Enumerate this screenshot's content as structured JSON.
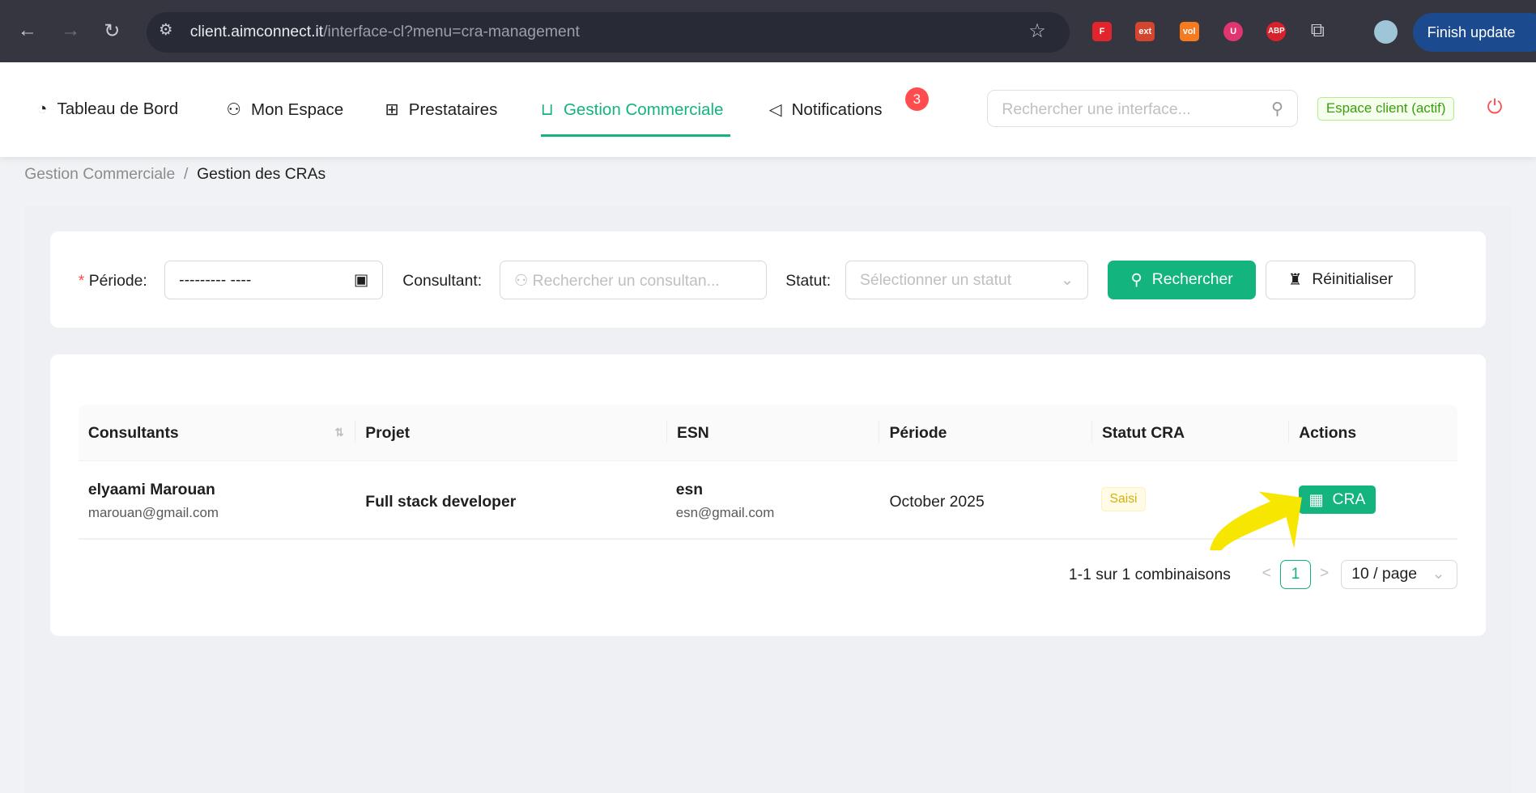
{
  "browser": {
    "url_host": "client.aimconnect.it",
    "url_path": "/interface-cl?menu=cra-management",
    "finish_update": "Finish update",
    "extensions": [
      "F",
      "ext",
      "vol",
      "U",
      "ABP"
    ]
  },
  "nav": {
    "items": [
      {
        "label": "Tableau de Bord",
        "icon": "dashboard-icon"
      },
      {
        "label": "Mon Espace",
        "icon": "user-icon"
      },
      {
        "label": "Prestataires",
        "icon": "blocks-icon"
      },
      {
        "label": "Gestion Commerciale",
        "icon": "shopping-bag-icon",
        "active": true
      },
      {
        "label": "Notifications",
        "icon": "megaphone-icon"
      }
    ],
    "notification_count": "3",
    "search_placeholder": "Rechercher une interface...",
    "client_tag": "Espace client (actif)",
    "accent": "#13b47e"
  },
  "breadcrumb": {
    "parent": "Gestion Commerciale",
    "separator": "/",
    "current": "Gestion des CRAs"
  },
  "filters": {
    "required_mark": "*",
    "periode_label": "Période",
    "periode_value": "--------- ----",
    "consultant_label": "Consultant",
    "consultant_placeholder": "Rechercher un consultan...",
    "statut_label": "Statut",
    "statut_placeholder": "Sélectionner un statut",
    "colon": ":",
    "search_button": "Rechercher",
    "reset_button": "Réinitialiser"
  },
  "table": {
    "columns": [
      "Consultants",
      "Projet",
      "ESN",
      "Période",
      "Statut CRA",
      "Actions"
    ],
    "rows": [
      {
        "consultant_name": "elyaami Marouan",
        "consultant_email": "marouan@gmail.com",
        "projet": "Full stack developer",
        "esn_name": "esn",
        "esn_email": "esn@gmail.com",
        "periode": "October 2025",
        "statut": "Saisi",
        "action": "CRA"
      }
    ]
  },
  "pagination": {
    "summary": "1-1 sur 1 combinaisons",
    "prev": "<",
    "page": "1",
    "next": ">",
    "page_size": "10 / page"
  }
}
